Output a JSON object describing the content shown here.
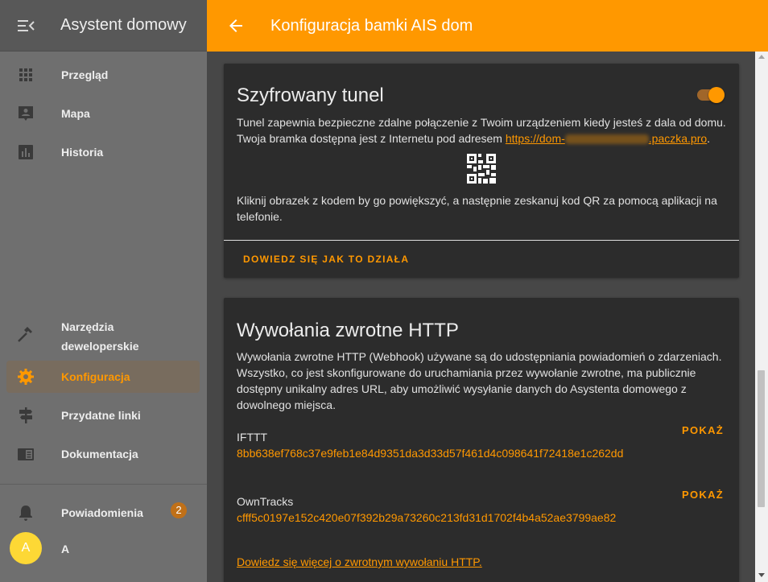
{
  "sidebar": {
    "title": "Asystent domowy",
    "items": [
      {
        "label": "Przegląd",
        "icon": "grid-icon"
      },
      {
        "label": "Mapa",
        "icon": "map-person-icon"
      },
      {
        "label": "Historia",
        "icon": "chart-icon"
      },
      {
        "label": "Narzędzia deweloperskie",
        "icon": "hammer-icon"
      },
      {
        "label": "Konfiguracja",
        "icon": "gear-icon",
        "active": true
      },
      {
        "label": "Przydatne linki",
        "icon": "signpost-icon"
      },
      {
        "label": "Dokumentacja",
        "icon": "book-icon"
      }
    ],
    "notifications": {
      "label": "Powiadomienia",
      "count": "2"
    },
    "user": {
      "initial": "A",
      "name": "A"
    }
  },
  "header": {
    "title": "Konfiguracja bamki AIS dom"
  },
  "tunnel_card": {
    "title": "Szyfrowany tunel",
    "enabled": true,
    "desc_line1": "Tunel zapewnia bezpieczne zdalne połączenie z Twoim urządzeniem kiedy jesteś z dala od domu.",
    "desc_line2_prefix": "Twoja bramka dostępna jest z Internetu pod adresem ",
    "link_start": "https://dom-",
    "link_end": ".paczka.pro",
    "desc_line2_suffix": ".",
    "qr_instruction": "Kliknij obrazek z kodem by go powiększyć, a następnie zeskanuj kod QR za pomocą aplikacji na telefonie.",
    "learn_button": "DOWIEDZ SIĘ JAK TO DZIAŁA"
  },
  "webhook_card": {
    "title": "Wywołania zwrotne HTTP",
    "description": "Wywołania zwrotne HTTP (Webhook) używane są do udostępniania powiadomień o zdarzeniach. Wszystko, co jest skonfigurowane do uruchamiania przez wywołanie zwrotne, ma publicznie dostępny unikalny adres URL, aby umożliwić wysyłanie danych do Asystenta domowego z dowolnego miejsca.",
    "hooks": [
      {
        "name": "IFTTT",
        "id": "8bb638ef768c37e9feb1e84d9351da3d33d57f461d4c098641f72418e1c262dd",
        "button": "POKAŻ"
      },
      {
        "name": "OwnTracks",
        "id": "cfff5c0197e152c420e07f392b29a73260c213fd31d1702f4b4a52ae3799ae82",
        "button": "POKAŻ"
      }
    ],
    "more_link": "Dowiedz się więcej o zwrotnym wywołaniu HTTP."
  },
  "colors": {
    "accent": "#ff9800",
    "sidebar_bg": "#6f6f6f",
    "card_bg": "#2c2c2c",
    "avatar": "#fdd835"
  }
}
